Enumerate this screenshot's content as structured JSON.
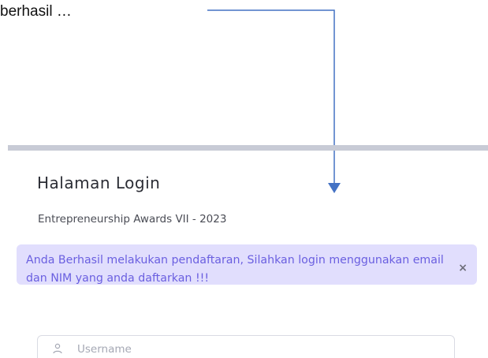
{
  "caption": "berhasil …",
  "login": {
    "title": "Halaman Login",
    "subtitle": "Entrepreneurship Awards VII - 2023"
  },
  "alert": {
    "message": "Anda Berhasil melakukan pendaftaran, Silahkan login menggunakan email dan NIM yang anda daftarkan !!!",
    "close_label": "×"
  },
  "form": {
    "username_placeholder": "Username",
    "username_value": "",
    "username_icon": "user-icon"
  },
  "colors": {
    "arrow": "#4472c4",
    "alert_bg": "#e1defd",
    "alert_text": "#6a5fe0",
    "divider": "#c8cbd6"
  }
}
